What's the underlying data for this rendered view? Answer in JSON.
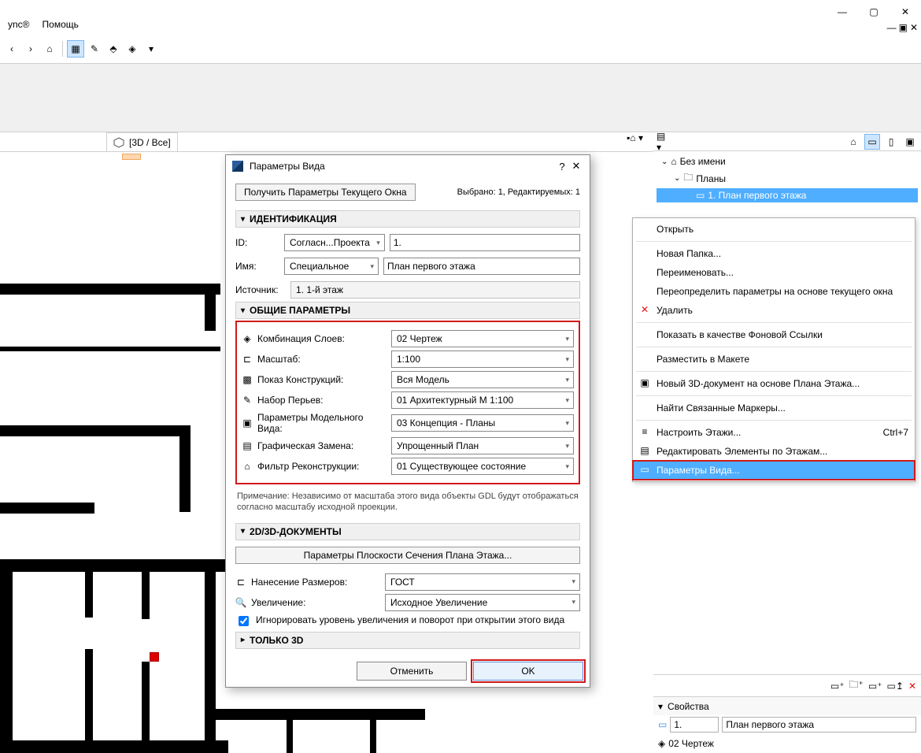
{
  "titlebar": {
    "min": "—",
    "max": "▢",
    "close": "✕",
    "rmin": "—",
    "rmax": "▣",
    "rclose": "✕"
  },
  "menu": {
    "sync": "ync®",
    "help": "Помощь"
  },
  "tab": {
    "label": "[3D / Все]"
  },
  "nav": {
    "root": "Без имени",
    "folder": "Планы",
    "view": "1. План первого этажа"
  },
  "ctx": {
    "open": "Открыть",
    "newfolder": "Новая Папка...",
    "rename": "Переименовать...",
    "override": "Переопределить параметры на основе текущего окна",
    "delete": "Удалить",
    "showbg": "Показать в качестве Фоновой Ссылки",
    "place": "Разместить в Макете",
    "new3d": "Новый 3D-документ на основе Плана Этажа...",
    "markers": "Найти Связанные Маркеры...",
    "stories": "Настроить Этажи...",
    "stories_kb": "Ctrl+7",
    "editbyfloor": "Редактировать Элементы по Этажам...",
    "viewsettings": "Параметры Вида..."
  },
  "dlg": {
    "title": "Параметры Вида",
    "help": "?",
    "close": "✕",
    "getbtn": "Получить Параметры Текущего Окна",
    "seltxt": "Выбрано: 1, Редактируемых: 1",
    "sec_ident": "ИДЕНТИФИКАЦИЯ",
    "idlbl": "ID:",
    "idsel": "Согласн...Проекта",
    "idval": "1.",
    "namelbl": "Имя:",
    "namesel": "Специальное",
    "nameval": "План первого этажа",
    "srclbl": "Источник:",
    "srcval": "1. 1-й этаж",
    "sec_general": "ОБЩИЕ ПАРАМЕТРЫ",
    "layers_lb": "Комбинация Слоев:",
    "layers": "02 Чертеж",
    "scale_lb": "Масштаб:",
    "scale": "1:100",
    "struct_lb": "Показ Конструкций:",
    "struct": "Вся Модель",
    "pens_lb": "Набор Перьев:",
    "pens": "01 Архитектурный М 1:100",
    "mview_lb": "Параметры Модельного Вида:",
    "mview": "03 Концепция - Планы",
    "gover_lb": "Графическая Замена:",
    "gover": "Упрощенный План",
    "reno_lb": "Фильтр Реконструкции:",
    "reno": "01 Существующее состояние",
    "note": "Примечание: Независимо от масштаба этого вида объекты GDL будут отображаться согласно масштабу исходной проекции.",
    "sec_2d3d": "2D/3D-ДОКУМЕНТЫ",
    "cutplane": "Параметры Плоскости Сечения Плана Этажа...",
    "dim_lb": "Нанесение Размеров:",
    "dim": "ГОСТ",
    "zoom_lb": "Увеличение:",
    "zoom": "Исходное Увеличение",
    "ignore": "Игнорировать уровень увеличения и поворот при открытии этого вида",
    "sec_3d": "ТОЛЬКО 3D",
    "cancel": "Отменить",
    "ok": "OK"
  },
  "props": {
    "header": "Свойства",
    "num": "1.",
    "name": "План первого этажа",
    "layers": "02 Чертеж"
  }
}
